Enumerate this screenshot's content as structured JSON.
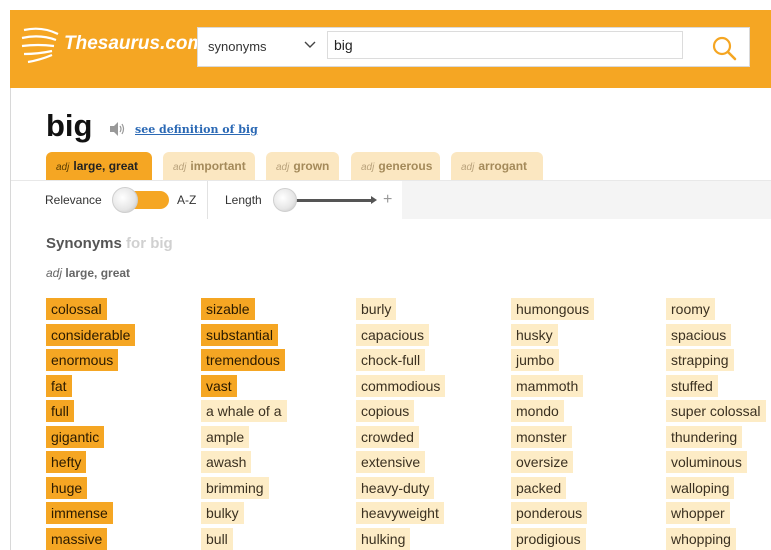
{
  "header": {
    "logo_text": "Thesaurus.com",
    "search_type": "synonyms",
    "search_value": "big"
  },
  "word": {
    "title": "big",
    "definition_link": "see definition of big"
  },
  "tabs": [
    {
      "pos": "adj",
      "label": "large, great",
      "active": true
    },
    {
      "pos": "adj",
      "label": "important",
      "active": false
    },
    {
      "pos": "adj",
      "label": "grown",
      "active": false
    },
    {
      "pos": "adj",
      "label": "generous",
      "active": false
    },
    {
      "pos": "adj",
      "label": "arrogant",
      "active": false
    }
  ],
  "filters": {
    "relevance_label": "Relevance",
    "az_label": "A-Z",
    "length_label": "Length",
    "plus": "+"
  },
  "synonyms": {
    "heading": "Synonyms",
    "heading_for": "for big",
    "sense_pos": "adj",
    "sense_label": "large, great",
    "columns": [
      [
        "colossal",
        "considerable",
        "enormous",
        "fat",
        "full",
        "gigantic",
        "hefty",
        "huge",
        "immense",
        "massive"
      ],
      [
        "sizable",
        "substantial",
        "tremendous",
        "vast",
        "a whale of a",
        "ample",
        "awash",
        "brimming",
        "bulky",
        "bull"
      ],
      [
        "burly",
        "capacious",
        "chock-full",
        "commodious",
        "copious",
        "crowded",
        "extensive",
        "heavy-duty",
        "heavyweight",
        "hulking"
      ],
      [
        "humongous",
        "husky",
        "jumbo",
        "mammoth",
        "mondo",
        "monster",
        "oversize",
        "packed",
        "ponderous",
        "prodigious"
      ],
      [
        "roomy",
        "spacious",
        "strapping",
        "stuffed",
        "super colossal",
        "thundering",
        "voluminous",
        "walloping",
        "whopper",
        "whopping"
      ]
    ],
    "strength": [
      [
        1,
        1,
        1,
        1,
        1,
        1,
        1,
        1,
        1,
        1
      ],
      [
        1,
        1,
        1,
        1,
        3,
        3,
        3,
        3,
        3,
        3
      ],
      [
        3,
        3,
        3,
        3,
        3,
        3,
        3,
        3,
        3,
        3
      ],
      [
        3,
        3,
        3,
        3,
        3,
        3,
        3,
        3,
        3,
        3
      ],
      [
        3,
        3,
        3,
        3,
        3,
        3,
        3,
        3,
        3,
        3
      ]
    ]
  },
  "colors": {
    "brand": "#f5a623",
    "strongest": "#f5a623",
    "strong": "#fbd489",
    "weak": "#fdecc6",
    "link": "#2b69b5"
  }
}
